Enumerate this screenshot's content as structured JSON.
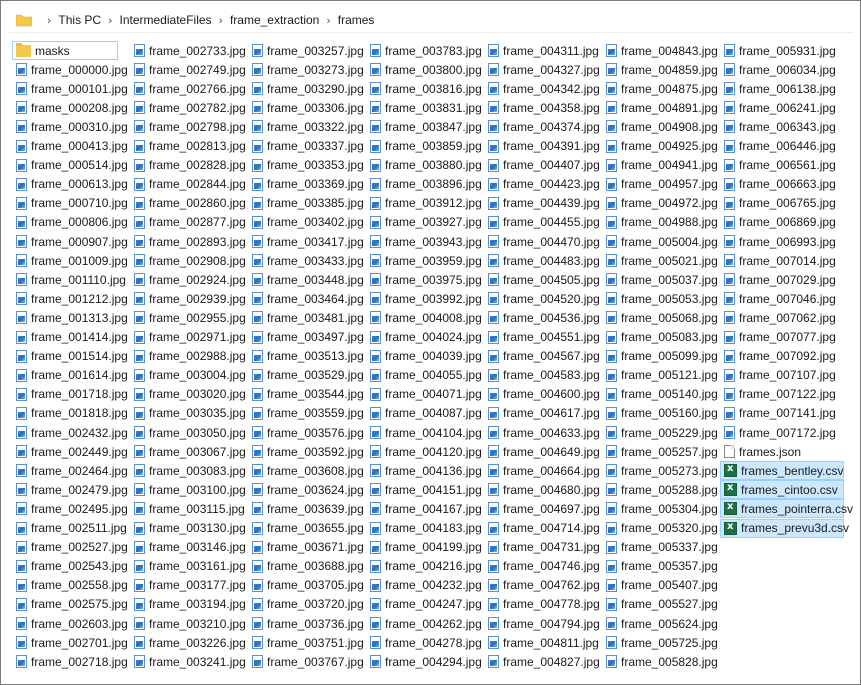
{
  "breadcrumb": {
    "items": [
      "This PC",
      "IntermediateFiles",
      "frame_extraction",
      "frames"
    ]
  },
  "columns": [
    [
      "masks",
      "frame_000000.jpg",
      "frame_000101.jpg",
      "frame_000208.jpg",
      "frame_000310.jpg",
      "frame_000413.jpg",
      "frame_000514.jpg",
      "frame_000613.jpg",
      "frame_000710.jpg",
      "frame_000806.jpg",
      "frame_000907.jpg",
      "frame_001009.jpg",
      "frame_001110.jpg",
      "frame_001212.jpg",
      "frame_001313.jpg",
      "frame_001414.jpg",
      "frame_001514.jpg",
      "frame_001614.jpg",
      "frame_001718.jpg",
      "frame_001818.jpg",
      "frame_002432.jpg",
      "frame_002449.jpg",
      "frame_002464.jpg",
      "frame_002479.jpg",
      "frame_002495.jpg",
      "frame_002511.jpg",
      "frame_002527.jpg",
      "frame_002543.jpg",
      "frame_002558.jpg",
      "frame_002575.jpg",
      "frame_002603.jpg",
      "frame_002701.jpg",
      "frame_002718.jpg"
    ],
    [
      "frame_002733.jpg",
      "frame_002749.jpg",
      "frame_002766.jpg",
      "frame_002782.jpg",
      "frame_002798.jpg",
      "frame_002813.jpg",
      "frame_002828.jpg",
      "frame_002844.jpg",
      "frame_002860.jpg",
      "frame_002877.jpg",
      "frame_002893.jpg",
      "frame_002908.jpg",
      "frame_002924.jpg",
      "frame_002939.jpg",
      "frame_002955.jpg",
      "frame_002971.jpg",
      "frame_002988.jpg",
      "frame_003004.jpg",
      "frame_003020.jpg",
      "frame_003035.jpg",
      "frame_003050.jpg",
      "frame_003067.jpg",
      "frame_003083.jpg",
      "frame_003100.jpg",
      "frame_003115.jpg",
      "frame_003130.jpg",
      "frame_003146.jpg",
      "frame_003161.jpg",
      "frame_003177.jpg",
      "frame_003194.jpg",
      "frame_003210.jpg",
      "frame_003226.jpg",
      "frame_003241.jpg"
    ],
    [
      "frame_003257.jpg",
      "frame_003273.jpg",
      "frame_003290.jpg",
      "frame_003306.jpg",
      "frame_003322.jpg",
      "frame_003337.jpg",
      "frame_003353.jpg",
      "frame_003369.jpg",
      "frame_003385.jpg",
      "frame_003402.jpg",
      "frame_003417.jpg",
      "frame_003433.jpg",
      "frame_003448.jpg",
      "frame_003464.jpg",
      "frame_003481.jpg",
      "frame_003497.jpg",
      "frame_003513.jpg",
      "frame_003529.jpg",
      "frame_003544.jpg",
      "frame_003559.jpg",
      "frame_003576.jpg",
      "frame_003592.jpg",
      "frame_003608.jpg",
      "frame_003624.jpg",
      "frame_003639.jpg",
      "frame_003655.jpg",
      "frame_003671.jpg",
      "frame_003688.jpg",
      "frame_003705.jpg",
      "frame_003720.jpg",
      "frame_003736.jpg",
      "frame_003751.jpg",
      "frame_003767.jpg"
    ],
    [
      "frame_003783.jpg",
      "frame_003800.jpg",
      "frame_003816.jpg",
      "frame_003831.jpg",
      "frame_003847.jpg",
      "frame_003859.jpg",
      "frame_003880.jpg",
      "frame_003896.jpg",
      "frame_003912.jpg",
      "frame_003927.jpg",
      "frame_003943.jpg",
      "frame_003959.jpg",
      "frame_003975.jpg",
      "frame_003992.jpg",
      "frame_004008.jpg",
      "frame_004024.jpg",
      "frame_004039.jpg",
      "frame_004055.jpg",
      "frame_004071.jpg",
      "frame_004087.jpg",
      "frame_004104.jpg",
      "frame_004120.jpg",
      "frame_004136.jpg",
      "frame_004151.jpg",
      "frame_004167.jpg",
      "frame_004183.jpg",
      "frame_004199.jpg",
      "frame_004216.jpg",
      "frame_004232.jpg",
      "frame_004247.jpg",
      "frame_004262.jpg",
      "frame_004278.jpg",
      "frame_004294.jpg"
    ],
    [
      "frame_004311.jpg",
      "frame_004327.jpg",
      "frame_004342.jpg",
      "frame_004358.jpg",
      "frame_004374.jpg",
      "frame_004391.jpg",
      "frame_004407.jpg",
      "frame_004423.jpg",
      "frame_004439.jpg",
      "frame_004455.jpg",
      "frame_004470.jpg",
      "frame_004483.jpg",
      "frame_004505.jpg",
      "frame_004520.jpg",
      "frame_004536.jpg",
      "frame_004551.jpg",
      "frame_004567.jpg",
      "frame_004583.jpg",
      "frame_004600.jpg",
      "frame_004617.jpg",
      "frame_004633.jpg",
      "frame_004649.jpg",
      "frame_004664.jpg",
      "frame_004680.jpg",
      "frame_004697.jpg",
      "frame_004714.jpg",
      "frame_004731.jpg",
      "frame_004746.jpg",
      "frame_004762.jpg",
      "frame_004778.jpg",
      "frame_004794.jpg",
      "frame_004811.jpg",
      "frame_004827.jpg"
    ],
    [
      "frame_004843.jpg",
      "frame_004859.jpg",
      "frame_004875.jpg",
      "frame_004891.jpg",
      "frame_004908.jpg",
      "frame_004925.jpg",
      "frame_004941.jpg",
      "frame_004957.jpg",
      "frame_004972.jpg",
      "frame_004988.jpg",
      "frame_005004.jpg",
      "frame_005021.jpg",
      "frame_005037.jpg",
      "frame_005053.jpg",
      "frame_005068.jpg",
      "frame_005083.jpg",
      "frame_005099.jpg",
      "frame_005121.jpg",
      "frame_005140.jpg",
      "frame_005160.jpg",
      "frame_005229.jpg",
      "frame_005257.jpg",
      "frame_005273.jpg",
      "frame_005288.jpg",
      "frame_005304.jpg",
      "frame_005320.jpg",
      "frame_005337.jpg",
      "frame_005357.jpg",
      "frame_005407.jpg",
      "frame_005527.jpg",
      "frame_005624.jpg",
      "frame_005725.jpg",
      "frame_005828.jpg"
    ],
    [
      "frame_005931.jpg",
      "frame_006034.jpg",
      "frame_006138.jpg",
      "frame_006241.jpg",
      "frame_006343.jpg",
      "frame_006446.jpg",
      "frame_006561.jpg",
      "frame_006663.jpg",
      "frame_006765.jpg",
      "frame_006869.jpg",
      "frame_006993.jpg",
      "frame_007014.jpg",
      "frame_007029.jpg",
      "frame_007046.jpg",
      "frame_007062.jpg",
      "frame_007077.jpg",
      "frame_007092.jpg",
      "frame_007107.jpg",
      "frame_007122.jpg",
      "frame_007141.jpg",
      "frame_007172.jpg",
      "frames.json",
      "frames_bentley.csv",
      "frames_cintoo.csv",
      "frames_pointerra.csv",
      "frames_prevu3d.csv"
    ]
  ],
  "selected_items": [
    "frames_bentley.csv",
    "frames_cintoo.csv",
    "frames_pointerra.csv"
  ],
  "focused_item": "frames_prevu3d.csv",
  "outlined_item": "masks",
  "colors": {
    "selection_bg": "#cce8ff",
    "selection_border": "#99d1ff",
    "folder": "#f2c94c",
    "excel": "#1e7145"
  }
}
